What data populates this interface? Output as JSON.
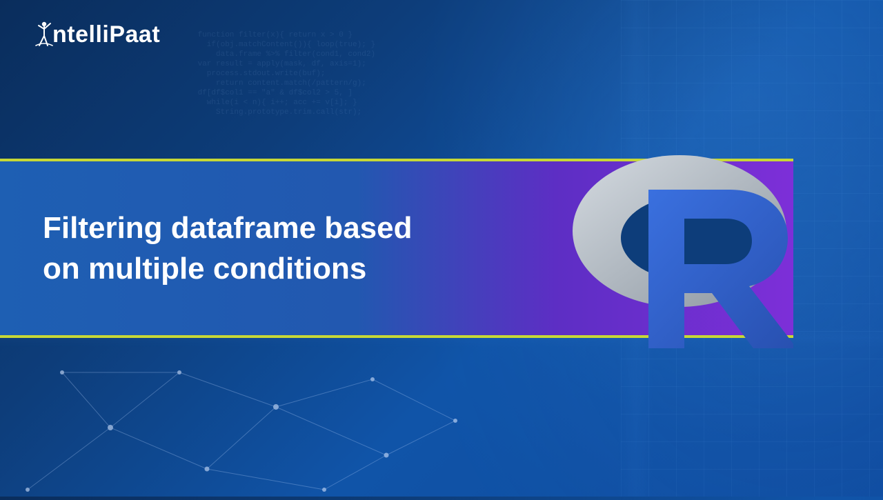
{
  "brand": {
    "name": "ntelliPaat"
  },
  "banner": {
    "line1": "Filtering dataframe based",
    "line2": "on multiple conditions"
  },
  "colors": {
    "accent": "#c7d836",
    "banner_left": "#1e5fb3",
    "banner_right": "#7d2fd8",
    "r_blue": "#3063c9",
    "r_ring": "#b8c0c8"
  }
}
